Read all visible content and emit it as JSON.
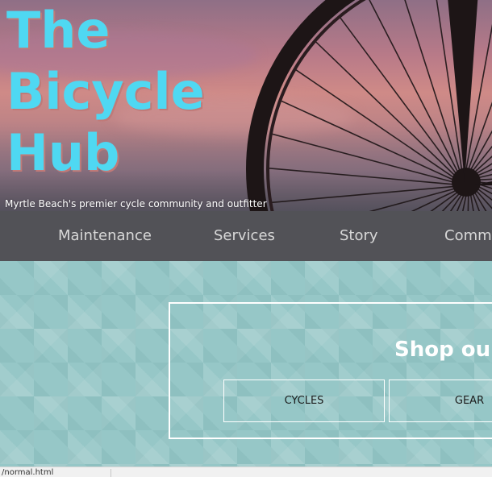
{
  "site": {
    "title_lines": [
      "The",
      "Bicycle",
      "Hub"
    ],
    "tagline": "Myrtle Beach's premier cycle community and outfitter"
  },
  "nav": {
    "items": [
      {
        "label": "Maintenance"
      },
      {
        "label": "Services"
      },
      {
        "label": "Story"
      },
      {
        "label": "Community"
      }
    ]
  },
  "shop": {
    "heading": "Shop our",
    "buttons": [
      {
        "label": "CYCLES"
      },
      {
        "label": "GEAR"
      }
    ]
  },
  "statusbar": {
    "url": "/normal.html"
  },
  "colors": {
    "title": "#4fd8f2",
    "nav_bg": "#46464b",
    "main_bg": "#96c7c7"
  }
}
